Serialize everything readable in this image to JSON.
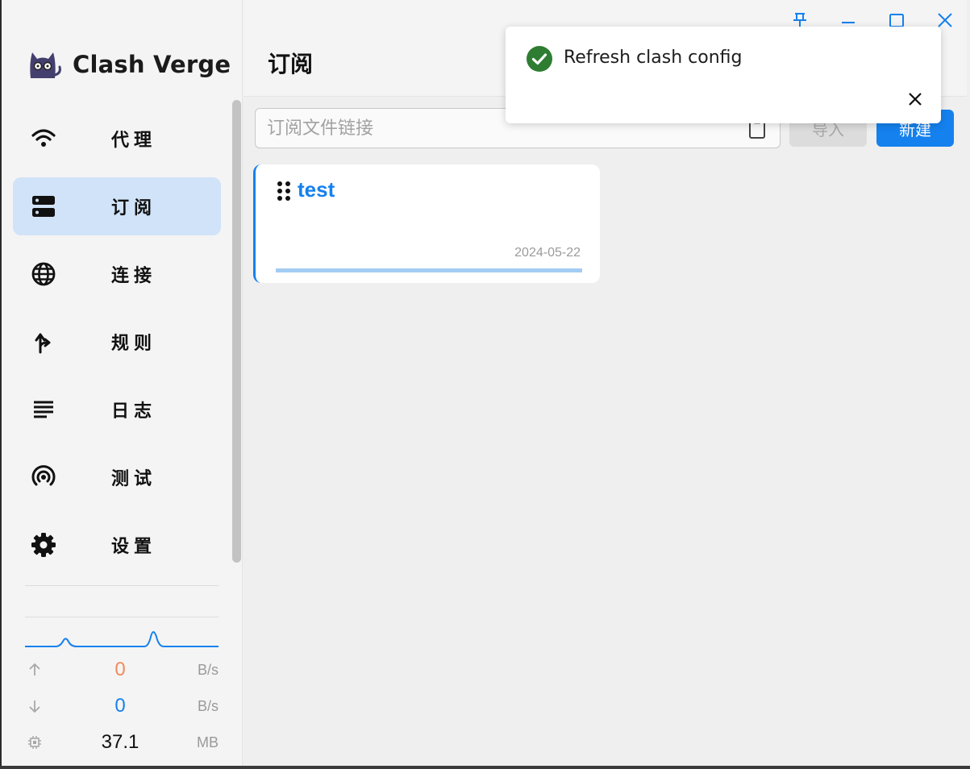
{
  "app": {
    "name": "Clash Verge"
  },
  "sidebar": {
    "items": [
      {
        "label": "代理",
        "icon": "wifi-icon"
      },
      {
        "label": "订阅",
        "icon": "dns-icon",
        "active": true
      },
      {
        "label": "连接",
        "icon": "globe-icon"
      },
      {
        "label": "规则",
        "icon": "fork-arrow-icon"
      },
      {
        "label": "日志",
        "icon": "lines-icon"
      },
      {
        "label": "测试",
        "icon": "signal-icon"
      },
      {
        "label": "设置",
        "icon": "gear-icon"
      }
    ],
    "traffic": {
      "upload": {
        "value": "0",
        "unit": "B/s",
        "color": "#f38a5b"
      },
      "download": {
        "value": "0",
        "unit": "B/s",
        "color": "#1581ee"
      },
      "memory": {
        "value": "37.1",
        "unit": "MB"
      }
    }
  },
  "header": {
    "title": "订阅"
  },
  "toolbar": {
    "url_placeholder": "订阅文件链接",
    "url_value": "",
    "import_label": "导入",
    "new_label": "新建"
  },
  "profiles": [
    {
      "name": "test",
      "date": "2024-05-22",
      "usage_fraction": 1.0
    }
  ],
  "toast": {
    "message": "Refresh clash config",
    "status": "success",
    "status_color": "#2e7d32"
  },
  "colors": {
    "accent": "#1581ee",
    "active_nav_bg": "#d1e3f8"
  }
}
